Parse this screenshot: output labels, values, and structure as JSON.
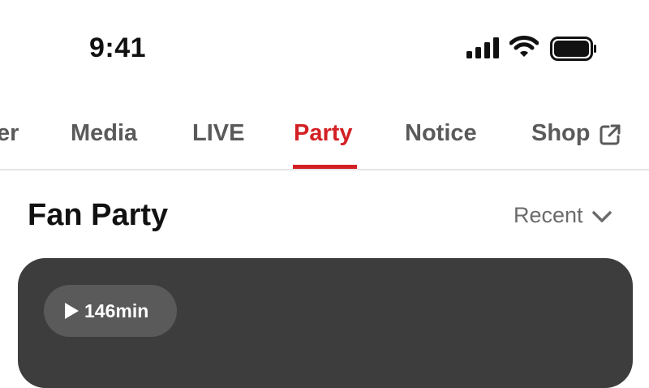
{
  "status_bar": {
    "time": "9:41",
    "icons": [
      "cellular-signal-icon",
      "wifi-icon",
      "battery-icon"
    ]
  },
  "tabs": {
    "items": [
      {
        "label": "er",
        "active": false
      },
      {
        "label": "Media",
        "active": false
      },
      {
        "label": "LIVE",
        "active": false
      },
      {
        "label": "Party",
        "active": true
      },
      {
        "label": "Notice",
        "active": false
      },
      {
        "label": "Shop",
        "active": false,
        "icon": "external-link-icon"
      }
    ]
  },
  "section": {
    "title": "Fan Party",
    "sort_label": "Recent",
    "sort_icon": "chevron-down-icon"
  },
  "card": {
    "duration": "146min",
    "duration_icon": "play-icon"
  },
  "colors": {
    "accent": "#d32024",
    "tab_inactive": "#5a5a5a",
    "card_bg": "#3d3d3d",
    "pill_bg": "#5a5a5a"
  }
}
